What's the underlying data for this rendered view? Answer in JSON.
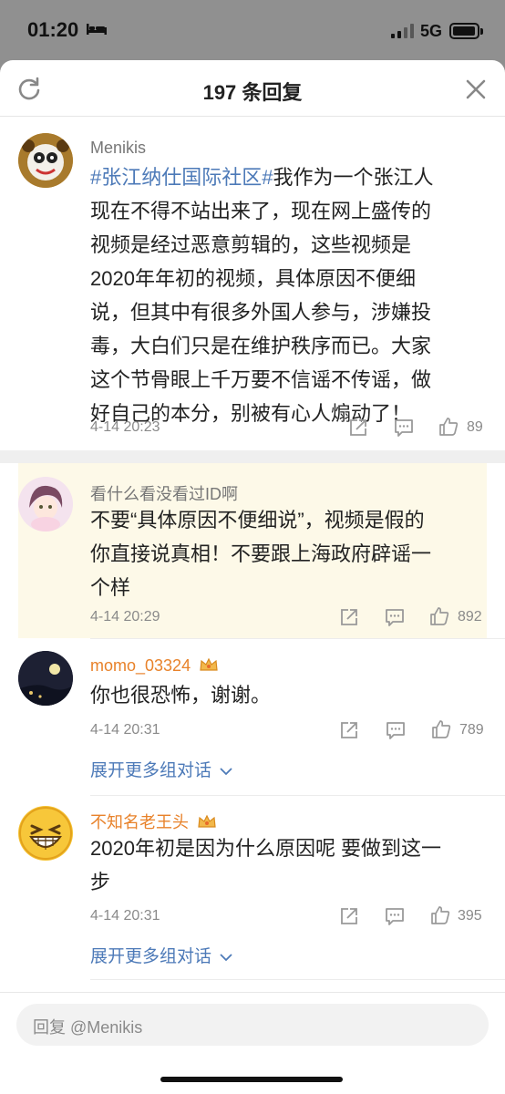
{
  "status_bar": {
    "time": "01:20",
    "network": "5G"
  },
  "header": {
    "title": "197 条回复"
  },
  "comments": [
    {
      "name": "Menikis",
      "hashtag": "#张江纳仕国际社区#",
      "lines": [
        "我作为一个张江人",
        "现在不得不站出来了，现在网上盛传的",
        "视频是经过恶意剪辑的，这些视频是",
        "2020年年初的视频，具体原因不便细",
        "说，但其中有很多外国人参与，涉嫌投",
        "毒，大白们只是在维护秩序而已。大家",
        "这个节骨眼上千万要不信谣不传谣，做",
        "好自己的本分，别被有心人煽动了！"
      ],
      "time": "4-14 20:23",
      "likes": "89"
    },
    {
      "name": "看什么看没看过ID啊",
      "lines": [
        "不要“具体原因不便细说”，视频是假的",
        "你直接说真相！不要跟上海政府辟谣一",
        "个样"
      ],
      "time": "4-14 20:29",
      "likes": "892",
      "highlight_color": "#fdf9e8"
    },
    {
      "name": "momo_03324",
      "lines": [
        "你也很恐怖，谢谢。"
      ],
      "time": "4-14 20:31",
      "likes": "789",
      "expand": "展开更多组对话"
    },
    {
      "name": "不知名老王头",
      "lines": [
        "2020年初是因为什么原因呢 要做到这一",
        "步"
      ],
      "time": "4-14 20:31",
      "likes": "395",
      "expand": "展开更多组对话"
    }
  ],
  "reply_bar": {
    "placeholder": "回复 @Menikis"
  },
  "colors": {
    "link_blue": "#4d7ab8",
    "vip_orange": "#e8822a",
    "highlight_bg": "#fdf9e8"
  }
}
